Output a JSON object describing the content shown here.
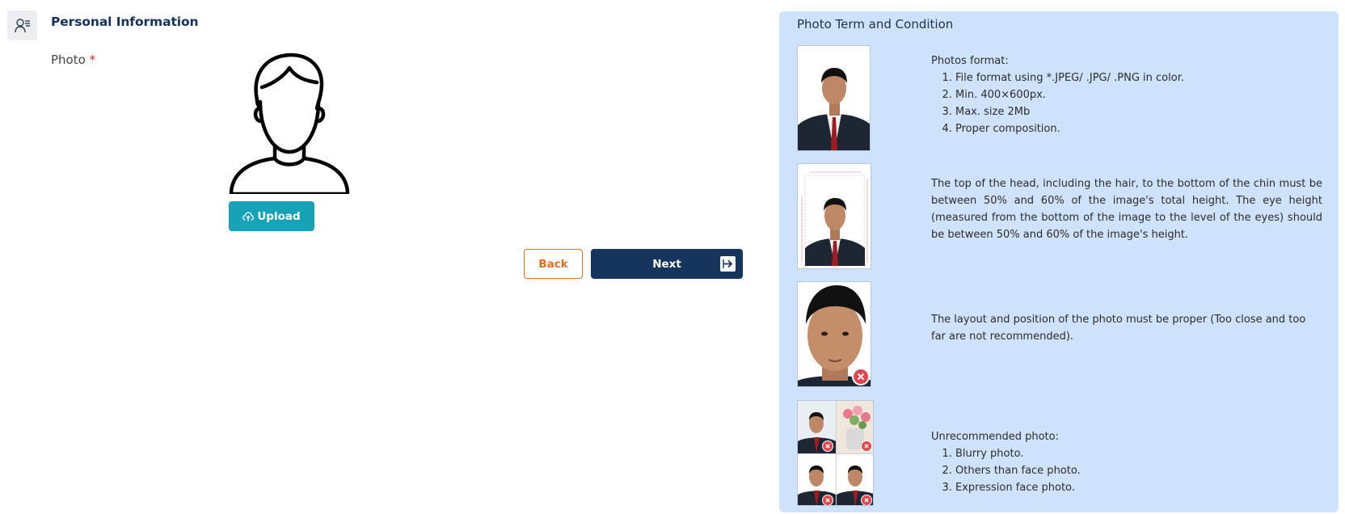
{
  "section": {
    "icon": "user-list-icon",
    "title": "Personal Information"
  },
  "photo": {
    "label": "Photo",
    "required_marker": "*",
    "avatar_icon": "user-avatar-icon",
    "upload_icon": "cloud-upload-icon",
    "upload_label": "Upload"
  },
  "nav": {
    "back_label": "Back",
    "next_label": "Next",
    "next_icon": "arrow-right-icon"
  },
  "terms": {
    "title": "Photo Term and Condition",
    "format": {
      "heading": "Photos format:",
      "items": [
        "File format using *.JPEG/ .JPG/ .PNG in color.",
        "Min. 400×600px.",
        "Max. size 2Mb",
        "Proper composition."
      ]
    },
    "composition_text": "The top of the head, including the hair, to the bottom of the chin must be between 50% and 60% of the image's total height. The eye height (measured from the bottom of the image to the level of the eyes) should be between 50% and 60% of the image's height.",
    "layout_text": "The layout and position of the photo must be proper (Too close and too far are not recommended).",
    "unrecommended": {
      "heading": "Unrecommended photo:",
      "items": [
        "Blurry photo.",
        "Others than face photo.",
        "Expression face photo."
      ]
    }
  },
  "colors": {
    "panel_bg": "#cfe2fb",
    "primary": "#16355c",
    "upload": "#17a2b8",
    "back": "#e36d1f",
    "reject": "#e0474f"
  }
}
